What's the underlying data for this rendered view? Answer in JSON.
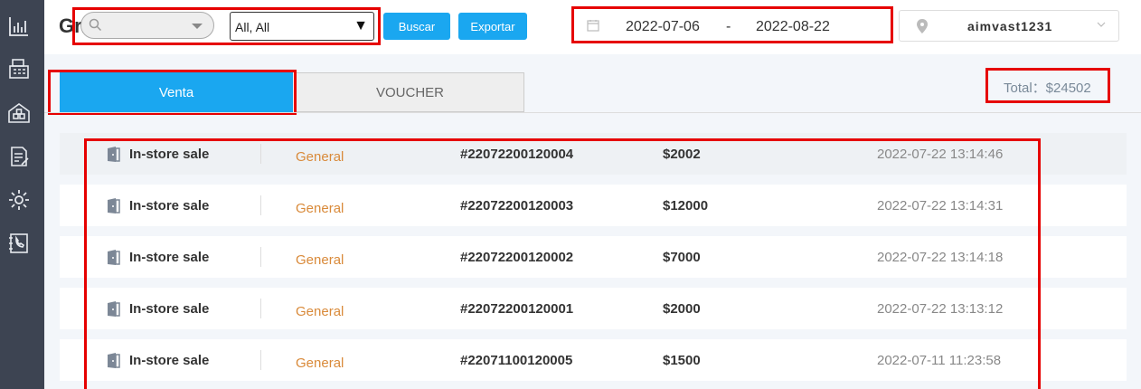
{
  "header": {
    "title": "Gr...",
    "search": {
      "placeholder": ""
    },
    "filter_select": {
      "value": "All, All"
    },
    "buttons": {
      "search": "Buscar",
      "export": "Exportar"
    },
    "date_range": {
      "start": "2022-07-06",
      "separator": "-",
      "end": "2022-08-22"
    },
    "store": {
      "name": "aimvast1231"
    }
  },
  "tabs": [
    {
      "label": "Venta",
      "active": true
    },
    {
      "label": "VOUCHER",
      "active": false
    }
  ],
  "total": {
    "label": "Total：$24502"
  },
  "transactions": [
    {
      "type": "In-store sale",
      "category": "General",
      "order": "#22072200120004",
      "amount": "$2002",
      "time": "2022-07-22 13:14:46"
    },
    {
      "type": "In-store sale",
      "category": "General",
      "order": "#22072200120003",
      "amount": "$12000",
      "time": "2022-07-22 13:14:31"
    },
    {
      "type": "In-store sale",
      "category": "General",
      "order": "#22072200120002",
      "amount": "$7000",
      "time": "2022-07-22 13:14:18"
    },
    {
      "type": "In-store sale",
      "category": "General",
      "order": "#22072200120001",
      "amount": "$2000",
      "time": "2022-07-22 13:13:12"
    },
    {
      "type": "In-store sale",
      "category": "General",
      "order": "#22071100120005",
      "amount": "$1500",
      "time": "2022-07-11 11:23:58"
    }
  ],
  "sidebar": {
    "items": [
      {
        "icon": "bar-chart-icon"
      },
      {
        "icon": "cash-register-icon"
      },
      {
        "icon": "warehouse-icon"
      },
      {
        "icon": "document-edit-icon"
      },
      {
        "icon": "gear-icon"
      },
      {
        "icon": "phone-book-icon"
      }
    ]
  },
  "colors": {
    "accent": "#1aa7f0",
    "sidebar": "#3d4452",
    "highlight": "#e60000",
    "category": "#d98a3a"
  }
}
